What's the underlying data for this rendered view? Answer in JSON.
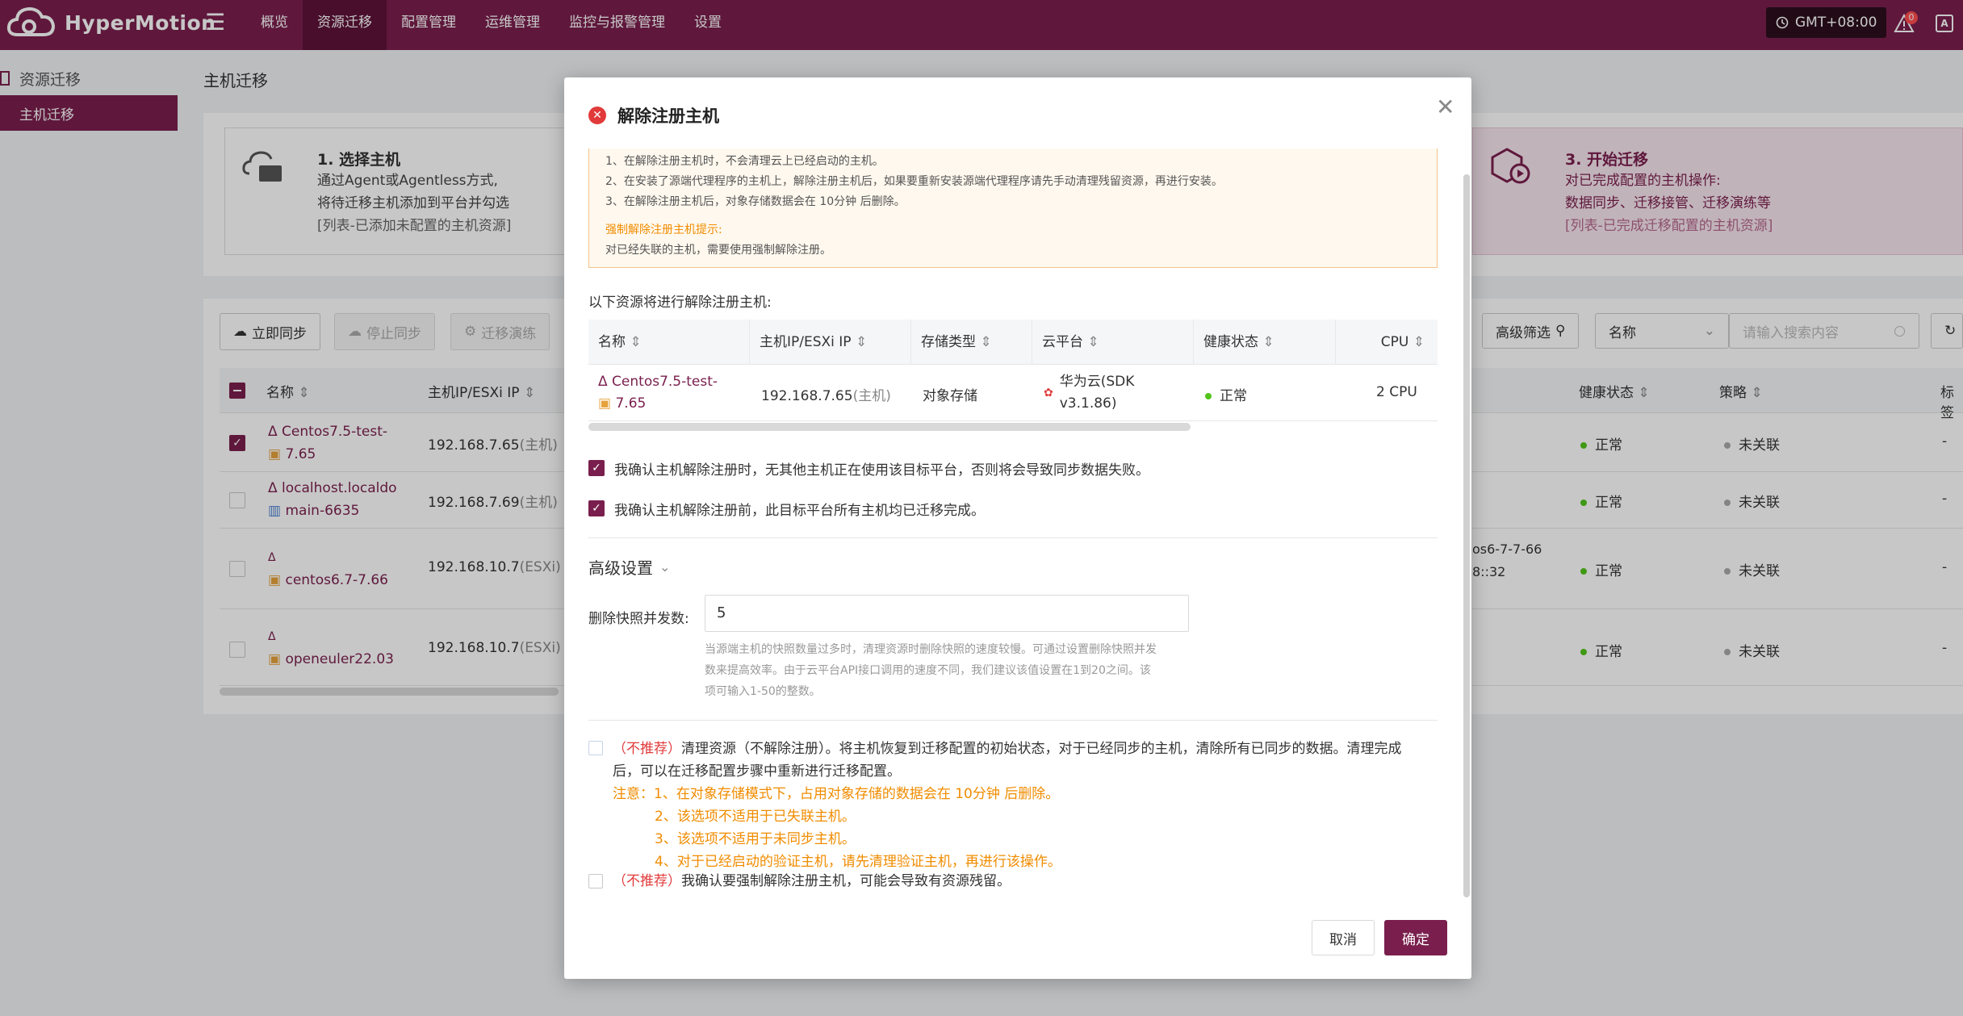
{
  "app": {
    "title": "HyperMotion"
  },
  "nav": {
    "items": [
      "概览",
      "资源迁移",
      "配置管理",
      "运维管理",
      "监控与报警管理",
      "设置"
    ],
    "active": "资源迁移"
  },
  "header": {
    "timezone": "GMT+08:00",
    "notification_count": "0",
    "user_icon_text": "A"
  },
  "sidebar": {
    "section": "资源迁移",
    "item": "主机迁移"
  },
  "page": {
    "title": "主机迁移"
  },
  "steps": {
    "step1": {
      "title": "1. 选择主机",
      "lines": [
        "通过Agent或Agentless方式,",
        "将待迁移主机添加到平台并勾选"
      ],
      "note": "[列表-已添加未配置的主机资源]"
    },
    "step3": {
      "title": "3. 开始迁移",
      "lines": [
        "对已完成配置的主机操作:",
        "数据同步、迁移接管、迁移演练等"
      ],
      "note": "[列表-已完成迁移配置的主机资源]"
    }
  },
  "toolbar": {
    "sync_now": "立即同步",
    "stop_sync": "停止同步",
    "drill": "迁移演练",
    "advanced_filter": "高级筛选",
    "filter_field": "名称",
    "search_placeholder": "请输入搜索内容"
  },
  "table": {
    "headers": {
      "name": "名称",
      "ip": "主机IP/ESXi IP",
      "health": "健康状态",
      "policy": "策略",
      "tag": "标签"
    },
    "rows": [
      {
        "name1": "Centos7.5-test-",
        "name2": "7.65",
        "ip": "192.168.7.65",
        "ip_note": "(主机)",
        "extra1": "",
        "extra2": "",
        "health": "正常",
        "policy": "未关联",
        "tag": "-",
        "checked": true
      },
      {
        "name1": "localhost.localdo",
        "name2": "main-6635",
        "ip": "192.168.7.69",
        "ip_note": "(主机)",
        "extra1": "",
        "extra2": "",
        "health": "正常",
        "policy": "未关联",
        "tag": "-",
        "checked": false
      },
      {
        "name1": "centos6.7-7.66",
        "name2": "",
        "ip": "192.168.10.7",
        "ip_note": "(ESXi)",
        "extra1": "os6-7-7-66",
        "extra2": "8::32",
        "health": "正常",
        "policy": "未关联",
        "tag": "-",
        "checked": false
      },
      {
        "name1": "openeuler22.03",
        "name2": "",
        "ip": "192.168.10.7",
        "ip_note": "(ESXi)",
        "extra1": "",
        "extra2": "",
        "health": "正常",
        "policy": "未关联",
        "tag": "-",
        "checked": false
      }
    ]
  },
  "modal": {
    "title": "解除注册主机",
    "warnings": [
      "1、在解除注册主机时，不会清理云上已经启动的主机。",
      "2、在安装了源端代理程序的主机上，解除注册主机后，如果要重新安装源端代理程序请先手动清理残留资源，再进行安装。",
      "3、在解除注册主机后，对象存储数据会在 10分钟 后删除。"
    ],
    "force_title": "强制解除注册主机提示:",
    "force_text": "对已经失联的主机，需要使用强制解除注册。",
    "resource_title": "以下资源将进行解除注册主机:",
    "table_headers": {
      "name": "名称",
      "ip": "主机IP/ESXi IP",
      "storage": "存储类型",
      "cloud": "云平台",
      "health": "健康状态",
      "cpu": "CPU"
    },
    "row": {
      "name1": "Centos7.5-test-",
      "name2": "7.65",
      "ip": "192.168.7.65",
      "ip_note": "(主机)",
      "storage": "对象存储",
      "cloud1": "华为云(SDK",
      "cloud2": "v3.1.86)",
      "health": "正常",
      "cpu": "2 CPU"
    },
    "confirm1": "我确认主机解除注册时，无其他主机正在使用该目标平台，否则将会导致同步数据失败。",
    "confirm2": "我确认主机解除注册前，此目标平台所有主机均已迁移完成。",
    "advanced": "高级设置",
    "snapshot_label": "删除快照并发数:",
    "snapshot_value": "5",
    "snapshot_hint": [
      "当源端主机的快照数量过多时，清理资源时删除快照的速度较慢。可通过设置删除快照并发",
      "数来提高效率。由于云平台API接口调用的速度不同，我们建议该值设置在1到20之间。该",
      "项可输入1-50的整数。"
    ],
    "opt1_tag": "（不推荐）",
    "opt1_text": "清理资源（不解除注册）。将主机恢复到迁移配置的初始状态，对于已经同步的主机，清除所有已同步的数据。清理完成",
    "opt1_text2": "后，可以在迁移配置步骤中重新进行迁移配置。",
    "notes": [
      "注意：1、在对象存储模式下，占用对象存储的数据会在 10分钟 后删除。",
      "2、该选项不适用于已失联主机。",
      "3、该选项不适用于未同步主机。",
      "4、对于已经启动的验证主机，请先清理验证主机，再进行该操作。"
    ],
    "opt2_tag": "（不推荐）",
    "opt2_text": "我确认要强制解除注册主机，可能会导致有资源残留。",
    "cancel": "取消",
    "ok": "确定"
  },
  "colors": {
    "brand": "#7a1f4d",
    "error": "#e23a3a",
    "warning": "#f08c00",
    "success": "#52c41a"
  }
}
